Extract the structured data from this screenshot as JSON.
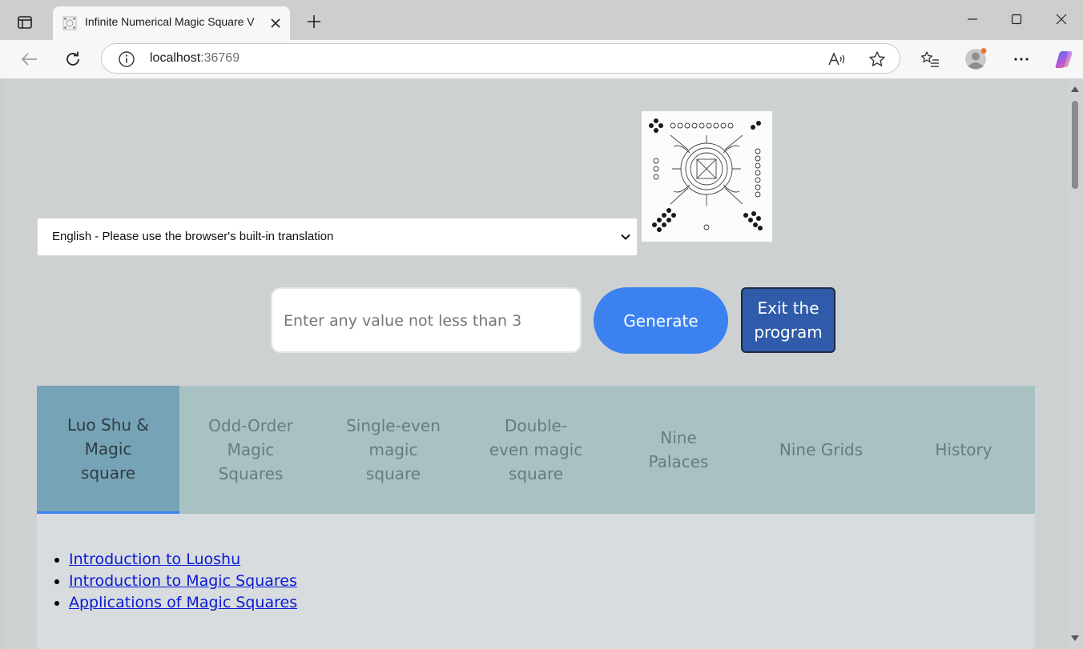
{
  "browser": {
    "tab_title": "Infinite Numerical Magic Square V",
    "url_host": "localhost",
    "url_port": ":36769"
  },
  "page": {
    "language_select": {
      "selected": "English - Please use the browser's built-in translation"
    },
    "value_input": {
      "placeholder": "Enter any value not less than 3"
    },
    "generate_label": "Generate",
    "exit_label": "Exit the program",
    "tabs": [
      {
        "label": "Luo Shu & Magic square",
        "active": true
      },
      {
        "label": "Odd-Order Magic Squares",
        "active": false
      },
      {
        "label": "Single-even magic square",
        "active": false
      },
      {
        "label": "Double-even magic square",
        "active": false
      },
      {
        "label": "Nine Palaces",
        "active": false
      },
      {
        "label": "Nine Grids",
        "active": false
      },
      {
        "label": "History",
        "active": false
      }
    ],
    "links": [
      "Introduction to Luoshu",
      "Introduction to Magic Squares",
      "Applications of Magic Squares"
    ]
  },
  "colors": {
    "accent": "#3b82f0",
    "exit_button": "#2f5baa",
    "tab_strip": "#a8c2c4",
    "active_tab": "#77a3b6",
    "link": "#0a1ad6"
  }
}
